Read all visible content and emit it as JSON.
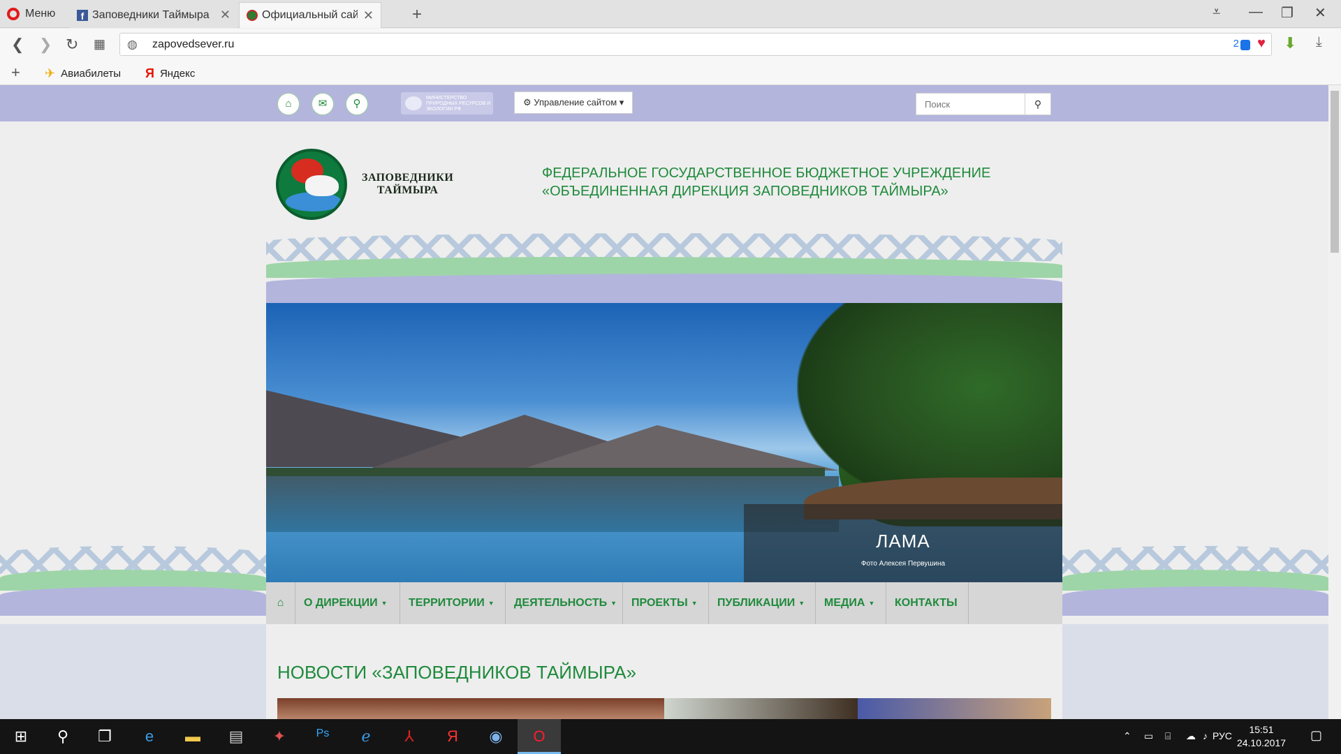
{
  "browser": {
    "menu_label": "Меню",
    "tabs": [
      {
        "label": "Заповедники Таймыра"
      },
      {
        "label": "Официальный сайт «Фед"
      }
    ],
    "url": "zapovedsever.ru",
    "badge_count": "2",
    "bookmarks": [
      "Авиабилеты",
      "Яндекс"
    ]
  },
  "site": {
    "ministry_text": "МИНИСТЕРСТВО ПРИРОДНЫХ РЕСУРСОВ И ЭКОЛОГИИ РФ",
    "manage_label": "Управление сайтом",
    "search_placeholder": "Поиск",
    "logo_line1": "ЗАПОВЕДНИКИ",
    "logo_line2": "ТАЙМЫРА",
    "agency_line1": "ФЕДЕРАЛЬНОЕ ГОСУДАРСТВЕННОЕ БЮДЖЕТНОЕ УЧРЕЖДЕНИЕ",
    "agency_line2": "«ОБЪЕДИНЕННАЯ ДИРЕКЦИЯ ЗАПОВЕДНИКОВ ТАЙМЫРА»",
    "slide_title": "ЛАМА",
    "slide_caption": "Фото Алексея Первушина",
    "menu": [
      {
        "label": "О ДИРЕКЦИИ",
        "dropdown": true
      },
      {
        "label": "ТЕРРИТОРИИ",
        "dropdown": true
      },
      {
        "label": "ДЕЯТЕЛЬНОСТЬ",
        "dropdown": true
      },
      {
        "label": "ПРОЕКТЫ",
        "dropdown": true
      },
      {
        "label": "ПУБЛИКАЦИИ",
        "dropdown": true
      },
      {
        "label": "МЕДИА",
        "dropdown": true
      },
      {
        "label": "КОНТАКТЫ",
        "dropdown": false
      }
    ],
    "news_heading": "НОВОСТИ «ЗАПОВЕДНИКОВ ТАЙМЫРА»"
  },
  "taskbar": {
    "language": "РУС",
    "time": "15:51",
    "date": "24.10.2017"
  },
  "colors": {
    "accent_green": "#1f8a3c",
    "strip_lavender": "#b3b5dd",
    "opera_red": "#e21a1a"
  }
}
